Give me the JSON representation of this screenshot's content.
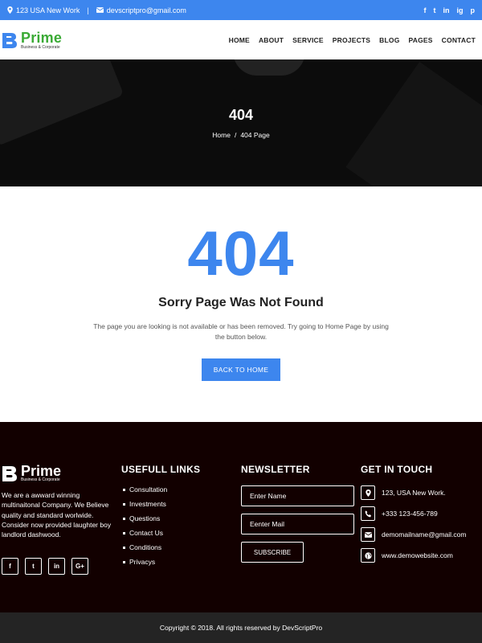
{
  "topbar": {
    "address": "123 USA New Work",
    "separator": "|",
    "email": "devscriptpro@gmail.com",
    "social": [
      "f",
      "t",
      "in",
      "ig",
      "p"
    ]
  },
  "header": {
    "logo_name": "Prime",
    "logo_tagline": "Business & Corporate",
    "nav": [
      "HOME",
      "ABOUT",
      "SERVICE",
      "PROJECTS",
      "BLOG",
      "PAGES",
      "CONTACT"
    ]
  },
  "banner": {
    "title": "404",
    "breadcrumb_home": "Home",
    "breadcrumb_sep": "/",
    "breadcrumb_current": "404 Page"
  },
  "error": {
    "code": "404",
    "heading": "Sorry Page Was Not Found",
    "message": "The page you are looking is not available or has been removed. Try going to Home Page by using the button below.",
    "button": "BACK TO HOME"
  },
  "footer": {
    "logo_name": "Prime",
    "logo_tagline": "Business & Corporate",
    "about": "We are a awward winning multinaitonal Company. We Believe quality and standard worlwide. Consider now provided laughter boy landlord dashwood.",
    "social": [
      "f",
      "t",
      "in",
      "G+"
    ],
    "links_title": "USEFULL LINKS",
    "links": [
      "Consultation",
      "Investments",
      "Questions",
      "Contact Us",
      "Conditions",
      "Privacys"
    ],
    "newsletter_title": "NEWSLETTER",
    "name_placeholder": "Enter Name",
    "mail_placeholder": "Eenter Mail",
    "subscribe": "SUBSCRIBE",
    "contact_title": "GET IN TOUCH",
    "address": "123, USA New Work.",
    "phone": "+333 123-456-789",
    "email": "demomailname@gmail.com",
    "website": "www.demowebsite.com"
  },
  "copyright": "Copyright © 2018. All rights reserved by DevScriptPro",
  "colors": {
    "accent": "#3d86ee",
    "logo_green": "#3aaa35",
    "footer_bg": "#120000",
    "copy_bg": "#242424"
  }
}
